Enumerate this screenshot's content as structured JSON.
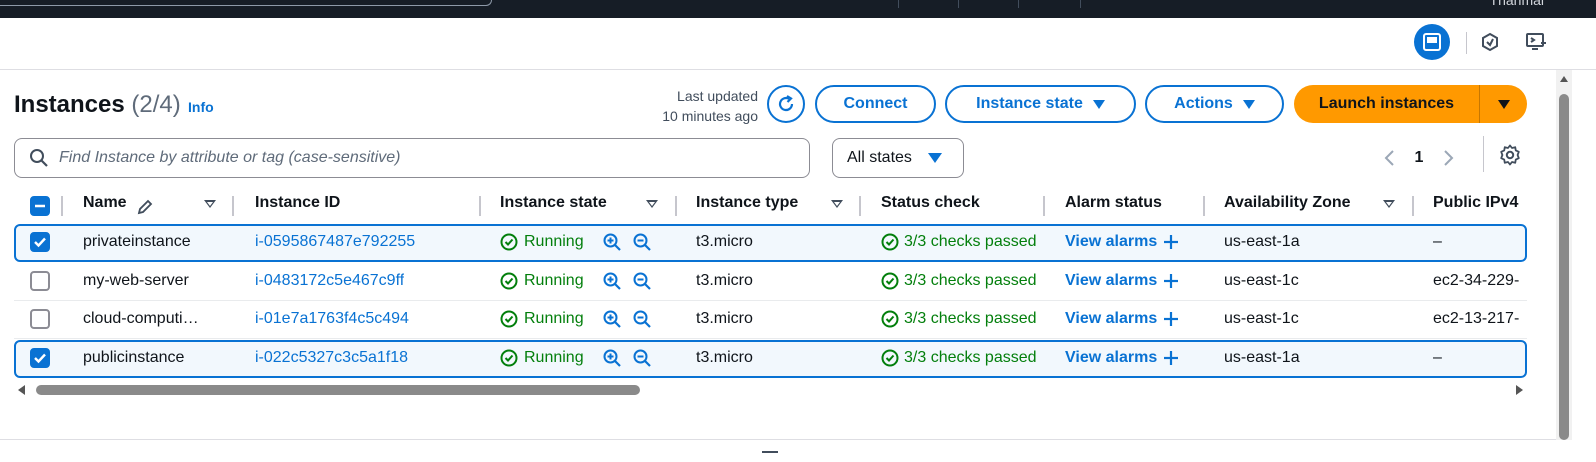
{
  "topbar": {
    "user": "Thanmai"
  },
  "header": {
    "title": "Instances",
    "count": "(2/4)",
    "info": "Info",
    "last_updated_line1": "Last updated",
    "last_updated_line2": "10 minutes ago"
  },
  "actions": {
    "connect": "Connect",
    "instance_state": "Instance state",
    "actions": "Actions",
    "launch": "Launch instances"
  },
  "filter": {
    "placeholder": "Find Instance by attribute or tag (case-sensitive)",
    "states": "All states"
  },
  "pagination": {
    "page": "1"
  },
  "columns": {
    "name": "Name",
    "instance_id": "Instance ID",
    "instance_state": "Instance state",
    "instance_type": "Instance type",
    "status_check": "Status check",
    "alarm_status": "Alarm status",
    "availability_zone": "Availability Zone",
    "public_ipv4": "Public IPv4"
  },
  "rows": [
    {
      "selected": true,
      "name": "privateinstance",
      "id": "i-0595867487e792255",
      "state": "Running",
      "type": "t3.micro",
      "status": "3/3 checks passed",
      "alarm": "View alarms",
      "zone": "us-east-1a",
      "ipv4": "–"
    },
    {
      "selected": false,
      "name": "my-web-server",
      "id": "i-0483172c5e467c9ff",
      "state": "Running",
      "type": "t3.micro",
      "status": "3/3 checks passed",
      "alarm": "View alarms",
      "zone": "us-east-1c",
      "ipv4": "ec2-34-229-"
    },
    {
      "selected": false,
      "name": "cloud-computi…",
      "id": "i-01e7a1763f4c5c494",
      "state": "Running",
      "type": "t3.micro",
      "status": "3/3 checks passed",
      "alarm": "View alarms",
      "zone": "us-east-1c",
      "ipv4": "ec2-13-217-"
    },
    {
      "selected": true,
      "name": "publicinstance",
      "id": "i-022c5327c3c5a1f18",
      "state": "Running",
      "type": "t3.micro",
      "status": "3/3 checks passed",
      "alarm": "View alarms",
      "zone": "us-east-1a",
      "ipv4": "–"
    }
  ],
  "colors": {
    "accent": "#0972d3",
    "success": "#037f0c",
    "launch": "#ff9900",
    "topbar": "#161d26"
  }
}
